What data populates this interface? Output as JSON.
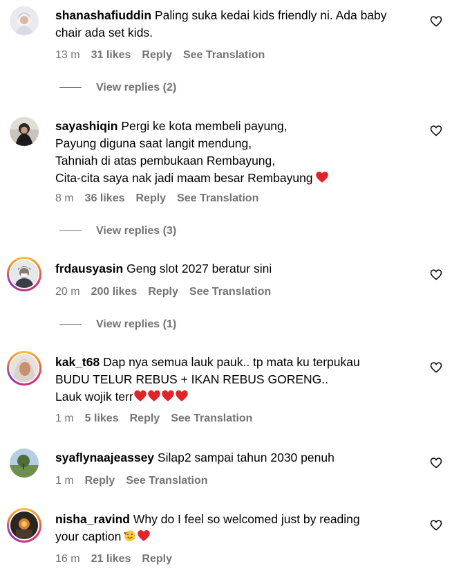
{
  "comments": [
    {
      "username": "shanashafiuddin",
      "lines": [
        "Paling suka kedai kids friendly ni. Ada baby",
        "chair ada set kids."
      ],
      "time": "13 m",
      "likes": "31 likes",
      "reply": "Reply",
      "translation": "See Translation",
      "view_replies": "View replies (2)"
    },
    {
      "username": "sayashiqin",
      "lines": [
        "Pergi ke kota membeli payung,",
        "Payung diguna saat langit mendung,",
        "Tahniah di atas pembukaan Rembayung,",
        "Cita-cita saya nak jadi maam besar Rembayung"
      ],
      "time": "8 m",
      "likes": "36 likes",
      "reply": "Reply",
      "translation": "See Translation",
      "view_replies": "View replies (3)"
    },
    {
      "username": "frdausyasin",
      "lines": [
        "Geng slot 2027 beratur sini"
      ],
      "time": "20 m",
      "likes": "200 likes",
      "reply": "Reply",
      "translation": "See Translation",
      "view_replies": "View replies (1)"
    },
    {
      "username": "kak_t68",
      "lines": [
        "Dap nya semua lauk pauk.. tp mata ku terpukau",
        "BUDU TELUR REBUS + IKAN REBUS GORENG..",
        "Lauk wojik terr"
      ],
      "time": "1 m",
      "likes": "5 likes",
      "reply": "Reply",
      "translation": "See Translation"
    },
    {
      "username": "syaflynaajeassey",
      "lines": [
        "Silap2 sampai tahun 2030 penuh"
      ],
      "time": "1 m",
      "reply": "Reply",
      "translation": "See Translation"
    },
    {
      "username": "nisha_ravind",
      "lines": [
        "Why do I feel so welcomed just by reading",
        "your caption"
      ],
      "time": "16 m",
      "likes": "21 likes",
      "reply": "Reply"
    }
  ],
  "icons": {
    "like": "heart-outline-icon",
    "emoji_heart": "red-heart-emoji",
    "emoji_face": "smiling-face-with-hearts-emoji"
  },
  "colors": {
    "text": "#000000",
    "secondary": "#737373",
    "heart_emoji": "#e0242b"
  }
}
